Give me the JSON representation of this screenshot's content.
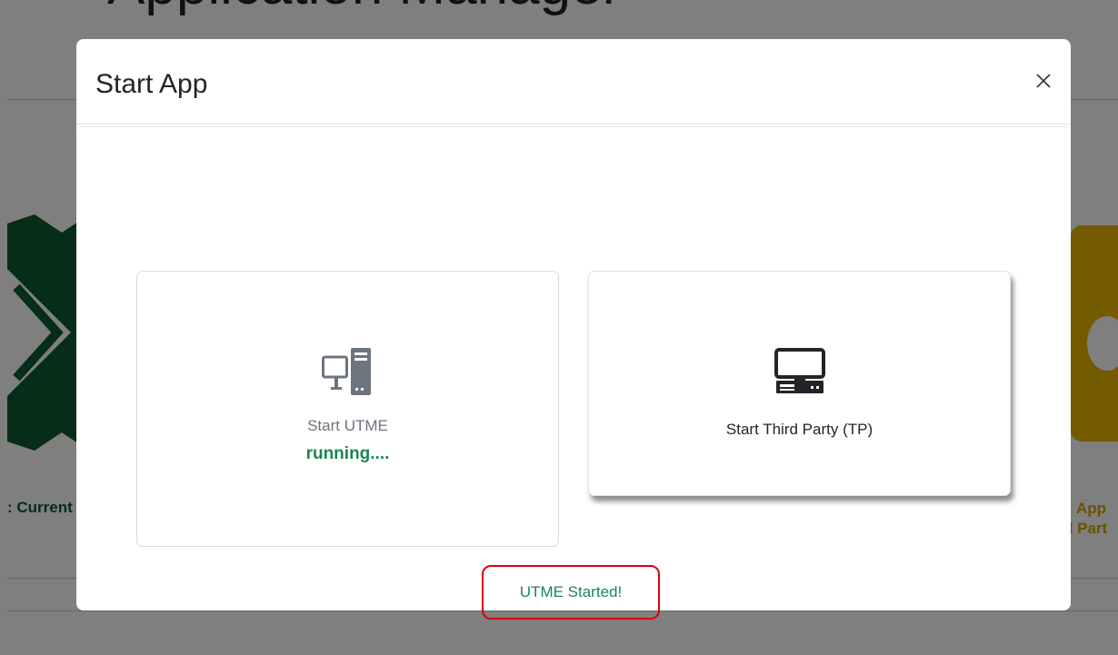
{
  "background": {
    "page_title": "Application Manager",
    "left_tile_label": ": Current",
    "right_tile_label_line1": "App",
    "right_tile_label_line2": "d Part",
    "gear_icon": "gear-icon",
    "colors": {
      "green": "#0a5a2f",
      "yellow": "#e8b400"
    }
  },
  "modal": {
    "title": "Start App",
    "close_icon": "close-icon",
    "cards": [
      {
        "label": "Start UTME",
        "status": "running....",
        "icon": "desktop-tower-icon"
      },
      {
        "label": "Start Third Party (TP)",
        "icon": "computer-icon"
      }
    ],
    "alert_text": "UTME Started!",
    "colors": {
      "success": "#198754",
      "alert_border": "#d9000d"
    }
  }
}
